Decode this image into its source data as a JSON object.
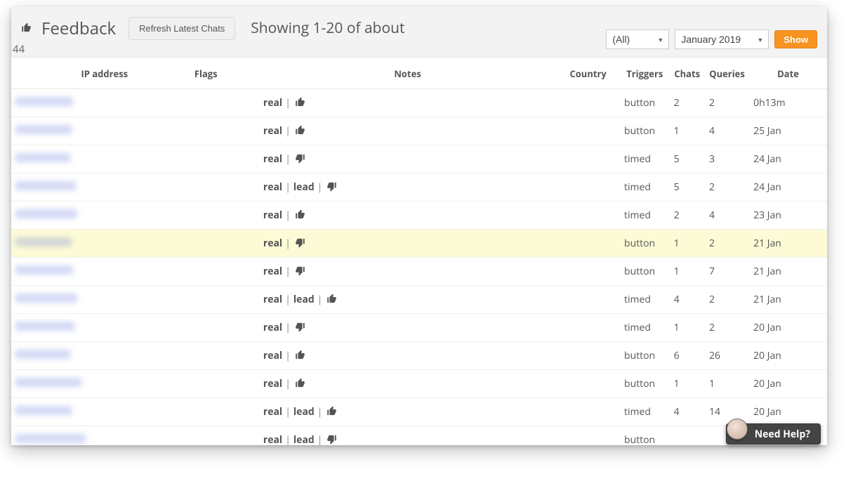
{
  "header": {
    "title": "Feedback",
    "refresh_label": "Refresh Latest Chats",
    "showing": "Showing 1-20 of about",
    "count_fragment": "44",
    "filter_selected": "(All)",
    "month_selected": "January 2019",
    "show_label": "Show"
  },
  "columns": {
    "ip": "IP address",
    "flags": "Flags",
    "notes": "Notes",
    "country": "Country",
    "triggers": "Triggers",
    "chats": "Chats",
    "queries": "Queries",
    "date": "Date"
  },
  "help": {
    "label": "Need Help?"
  },
  "rows": [
    {
      "ip_blur_w": 82,
      "tags": [
        "real"
      ],
      "thumb": "up",
      "trigger": "button",
      "chats": "2",
      "queries": "2",
      "date": "0h13m",
      "highlight": false
    },
    {
      "ip_blur_w": 80,
      "tags": [
        "real"
      ],
      "thumb": "up",
      "trigger": "button",
      "chats": "1",
      "queries": "4",
      "date": "25 Jan",
      "highlight": false
    },
    {
      "ip_blur_w": 78,
      "tags": [
        "real"
      ],
      "thumb": "down",
      "trigger": "timed",
      "chats": "5",
      "queries": "3",
      "date": "24 Jan",
      "highlight": false
    },
    {
      "ip_blur_w": 86,
      "tags": [
        "real",
        "lead"
      ],
      "thumb": "down",
      "trigger": "timed",
      "chats": "5",
      "queries": "2",
      "date": "24 Jan",
      "highlight": false
    },
    {
      "ip_blur_w": 88,
      "tags": [
        "real"
      ],
      "thumb": "up",
      "trigger": "timed",
      "chats": "2",
      "queries": "4",
      "date": "23 Jan",
      "highlight": false
    },
    {
      "ip_blur_w": 80,
      "tags": [
        "real"
      ],
      "thumb": "down",
      "trigger": "button",
      "chats": "1",
      "queries": "2",
      "date": "21 Jan",
      "highlight": true
    },
    {
      "ip_blur_w": 82,
      "tags": [
        "real"
      ],
      "thumb": "down",
      "trigger": "button",
      "chats": "1",
      "queries": "7",
      "date": "21 Jan",
      "highlight": false
    },
    {
      "ip_blur_w": 88,
      "tags": [
        "real",
        "lead"
      ],
      "thumb": "up",
      "trigger": "timed",
      "chats": "4",
      "queries": "2",
      "date": "21 Jan",
      "highlight": false
    },
    {
      "ip_blur_w": 84,
      "tags": [
        "real"
      ],
      "thumb": "down",
      "trigger": "timed",
      "chats": "1",
      "queries": "2",
      "date": "20 Jan",
      "highlight": false
    },
    {
      "ip_blur_w": 78,
      "tags": [
        "real"
      ],
      "thumb": "up",
      "trigger": "button",
      "chats": "6",
      "queries": "26",
      "date": "20 Jan",
      "highlight": false
    },
    {
      "ip_blur_w": 94,
      "tags": [
        "real"
      ],
      "thumb": "up",
      "trigger": "button",
      "chats": "1",
      "queries": "1",
      "date": "20 Jan",
      "highlight": false
    },
    {
      "ip_blur_w": 80,
      "tags": [
        "real",
        "lead"
      ],
      "thumb": "up",
      "trigger": "timed",
      "chats": "4",
      "queries": "14",
      "date": "20 Jan",
      "highlight": false
    },
    {
      "ip_blur_w": 100,
      "tags": [
        "real",
        "lead"
      ],
      "thumb": "down",
      "trigger": "button",
      "chats": "",
      "queries": "",
      "date": "",
      "highlight": false
    }
  ]
}
